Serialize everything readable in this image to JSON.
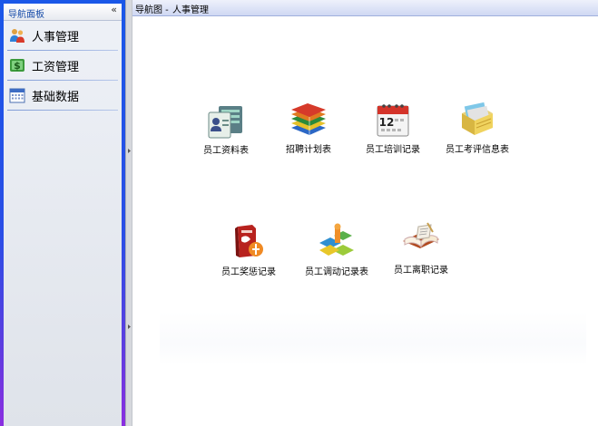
{
  "nav": {
    "title": "导航面板",
    "collapse_glyph": "«",
    "items": [
      {
        "label": "人事管理",
        "icon": "people-icon"
      },
      {
        "label": "工资管理",
        "icon": "money-icon"
      },
      {
        "label": "基础数据",
        "icon": "calendar-icon"
      }
    ]
  },
  "breadcrumb": {
    "prefix": "导航图 -",
    "current": "人事管理"
  },
  "tiles": [
    {
      "label": "员工资料表",
      "icon": "employee-card-icon"
    },
    {
      "label": "招聘计划表",
      "icon": "books-icon"
    },
    {
      "label": "员工培训记录",
      "icon": "calendar-12-icon",
      "day": "12"
    },
    {
      "label": "员工考评信息表",
      "icon": "file-folders-icon"
    },
    {
      "label": "员工奖惩记录",
      "icon": "reward-punish-icon"
    },
    {
      "label": "员工调动记录表",
      "icon": "transfer-icon"
    },
    {
      "label": "员工离职记录",
      "icon": "open-book-icon"
    }
  ]
}
